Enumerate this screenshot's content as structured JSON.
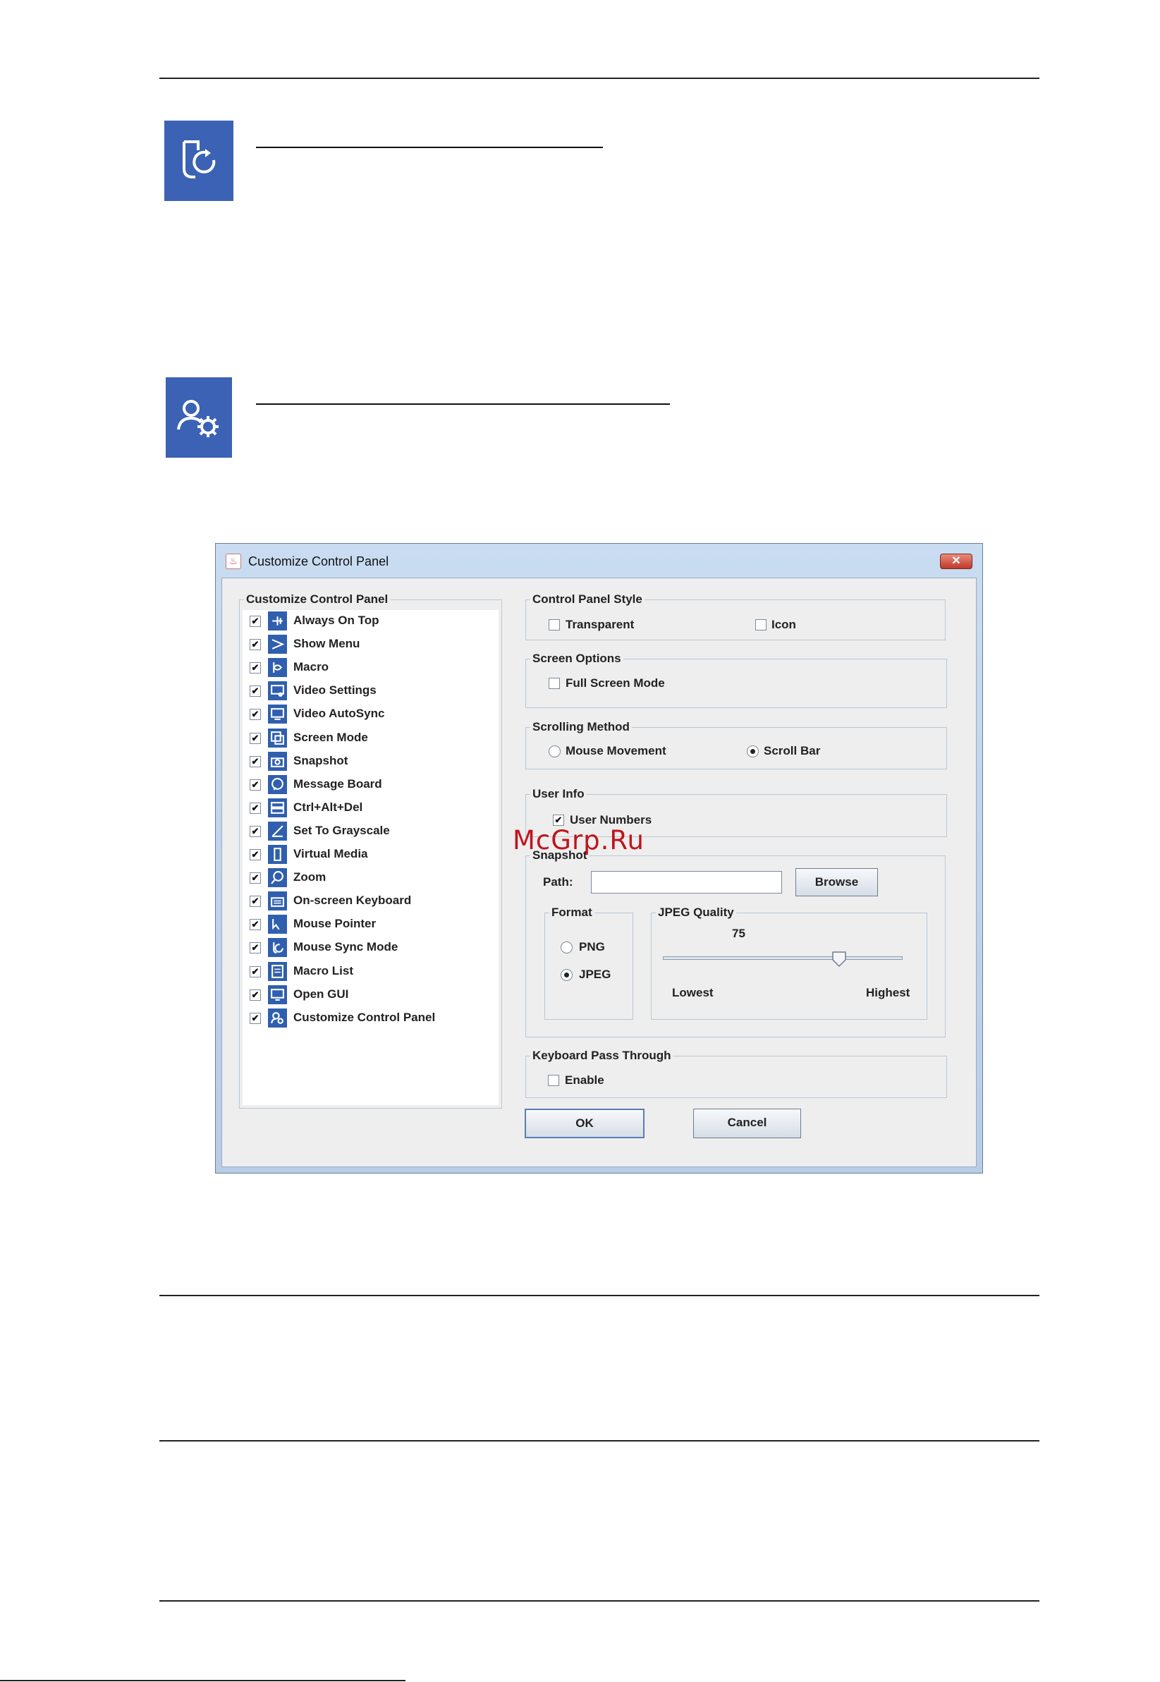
{
  "watermark": "McGrp.Ru",
  "dialog": {
    "title": "Customize Control Panel",
    "close_glyph": "✕",
    "list_panel": {
      "title": "Customize Control Panel",
      "items": [
        {
          "label": "Always On Top",
          "checked": true,
          "icon": "pin-icon"
        },
        {
          "label": "Show Menu",
          "checked": true,
          "icon": "menu-arrow-icon"
        },
        {
          "label": "Macro",
          "checked": true,
          "icon": "macro-icon"
        },
        {
          "label": "Video Settings",
          "checked": true,
          "icon": "video-settings-icon"
        },
        {
          "label": "Video AutoSync",
          "checked": true,
          "icon": "video-autosync-icon"
        },
        {
          "label": "Screen Mode",
          "checked": true,
          "icon": "screen-mode-icon"
        },
        {
          "label": "Snapshot",
          "checked": true,
          "icon": "camera-icon"
        },
        {
          "label": "Message Board",
          "checked": true,
          "icon": "message-board-icon"
        },
        {
          "label": "Ctrl+Alt+Del",
          "checked": true,
          "icon": "ctrl-alt-del-icon"
        },
        {
          "label": "Set To Grayscale",
          "checked": true,
          "icon": "grayscale-icon"
        },
        {
          "label": "Virtual Media",
          "checked": true,
          "icon": "virtual-media-icon"
        },
        {
          "label": "Zoom",
          "checked": true,
          "icon": "zoom-icon"
        },
        {
          "label": "On-screen Keyboard",
          "checked": true,
          "icon": "keyboard-icon"
        },
        {
          "label": "Mouse Pointer",
          "checked": true,
          "icon": "mouse-pointer-icon"
        },
        {
          "label": "Mouse Sync Mode",
          "checked": true,
          "icon": "mouse-sync-icon"
        },
        {
          "label": "Macro List",
          "checked": true,
          "icon": "macro-list-icon"
        },
        {
          "label": "Open GUI",
          "checked": true,
          "icon": "open-gui-icon"
        },
        {
          "label": "Customize Control Panel",
          "checked": true,
          "icon": "customize-panel-icon"
        }
      ]
    },
    "control_panel_style": {
      "title": "Control Panel Style",
      "transparent": {
        "label": "Transparent",
        "checked": false
      },
      "icon": {
        "label": "Icon",
        "checked": false
      }
    },
    "screen_options": {
      "title": "Screen Options",
      "full_screen": {
        "label": "Full Screen Mode",
        "checked": false
      }
    },
    "scrolling_method": {
      "title": "Scrolling Method",
      "mouse_movement": {
        "label": "Mouse Movement",
        "selected": false
      },
      "scroll_bar": {
        "label": "Scroll Bar",
        "selected": true
      }
    },
    "user_info": {
      "title": "User Info",
      "user_numbers": {
        "label": "User Numbers",
        "checked": true
      }
    },
    "snapshot": {
      "title": "Snapshot",
      "path_label": "Path:",
      "path_value": "",
      "browse_label": "Browse",
      "format": {
        "title": "Format",
        "png": {
          "label": "PNG",
          "selected": false
        },
        "jpeg": {
          "label": "JPEG",
          "selected": true
        }
      },
      "jpeg_quality": {
        "title": "JPEG Quality",
        "value": "75",
        "min": 0,
        "max": 100,
        "current": 75,
        "lowest_label": "Lowest",
        "highest_label": "Highest"
      }
    },
    "keyboard_pass_through": {
      "title": "Keyboard Pass Through",
      "enable": {
        "label": "Enable",
        "checked": false
      }
    },
    "ok_label": "OK",
    "cancel_label": "Cancel"
  },
  "check_glyph": "✔",
  "colors": {
    "icon_blue": "#3b62b4",
    "watermark_red": "#c0141a"
  }
}
